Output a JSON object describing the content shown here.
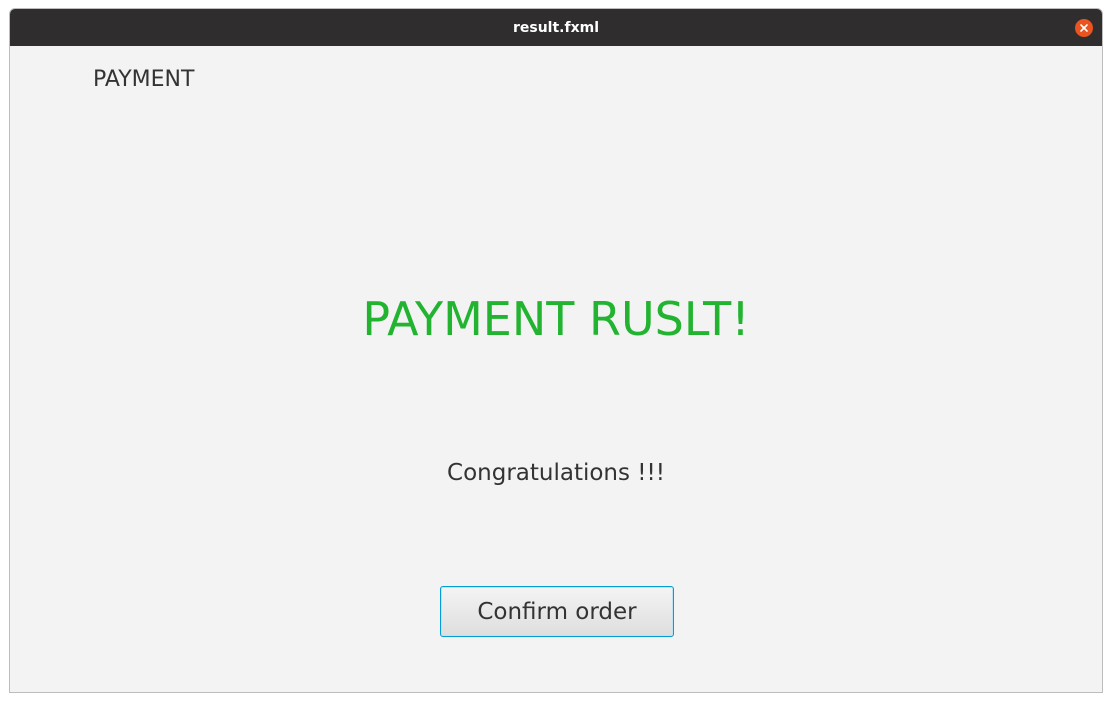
{
  "window": {
    "title": "result.fxml"
  },
  "header": {
    "label": "PAYMENT"
  },
  "main": {
    "result_title": "PAYMENT RUSLT!",
    "message": "Congratulations !!!",
    "confirm_label": "Confirm order"
  },
  "colors": {
    "titlebar": "#2f2d2e",
    "close_button": "#e95420",
    "success_text": "#22b430",
    "focus_border": "#039ed3"
  },
  "icons": {
    "close": "close-icon"
  }
}
